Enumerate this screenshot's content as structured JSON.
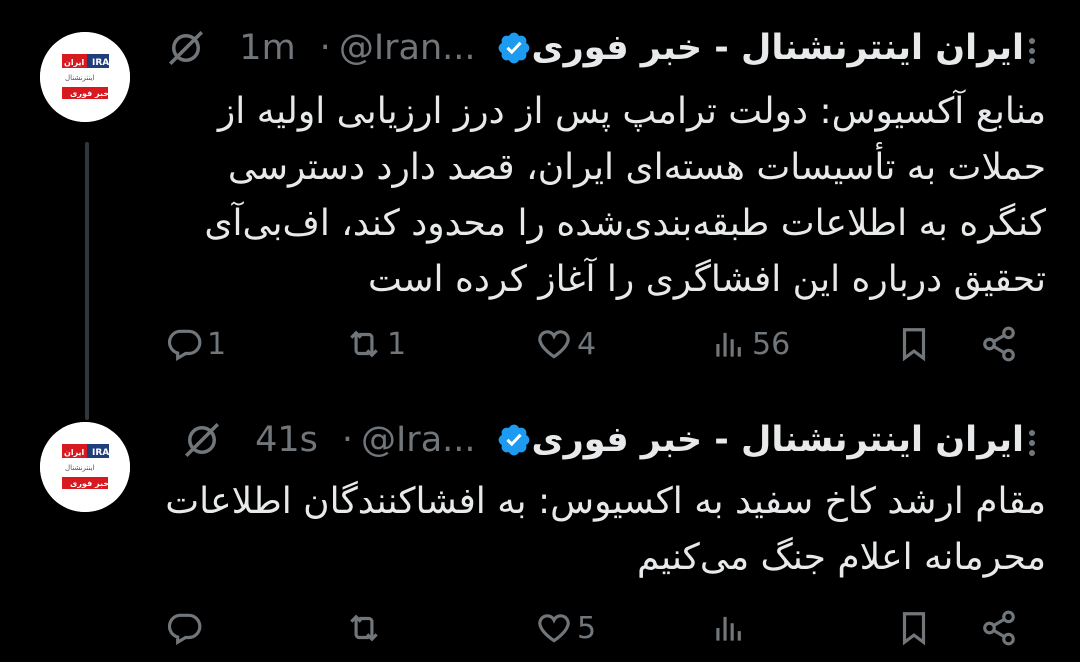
{
  "tweets": [
    {
      "author": "ایران اینترنشنال - خبر فوری",
      "handle": "@Iran...",
      "separator": "·",
      "time": "1m",
      "lines": [
        "منابع آکسیوس: دولت ترامپ پس از درز ارزیابی اولیه از",
        "حملات به تأسیسات هسته‌ای ایران، قصد دارد دسترسی",
        "کنگره به اطلاعات طبقه‌بندی‌شده را محدود کند، اف‌بی‌آی",
        "تحقیق درباره این افشاگری را آغاز کرده است"
      ],
      "stats": {
        "replies": "1",
        "reposts": "1",
        "likes": "4",
        "views": "56"
      }
    },
    {
      "author": "ایران اینترنشنال - خبر فوری",
      "handle": "@Ira...",
      "separator": "·",
      "time": "41s",
      "lines": [
        "مقام ارشد کاخ سفید به اکسیوس: به افشاکنندگان اطلاعات",
        "محرمانه اعلام جنگ می‌کنیم"
      ],
      "stats": {
        "replies": "",
        "reposts": "",
        "likes": "5",
        "views": ""
      }
    }
  ],
  "avatar_logo": {
    "line1": "IRAN",
    "line2": "ایران",
    "line3": "اینترنشنال",
    "line4": "خبر فوری"
  },
  "colors": {
    "background": "#000000",
    "text": "#e7e9ea",
    "muted": "#71767b",
    "verified": "#1d9bf0",
    "brand_red": "#d71920"
  },
  "icons": [
    "verified-badge-icon",
    "grok-icon",
    "more-icon",
    "reply-icon",
    "repost-icon",
    "like-icon",
    "views-icon",
    "bookmark-icon",
    "share-icon"
  ]
}
